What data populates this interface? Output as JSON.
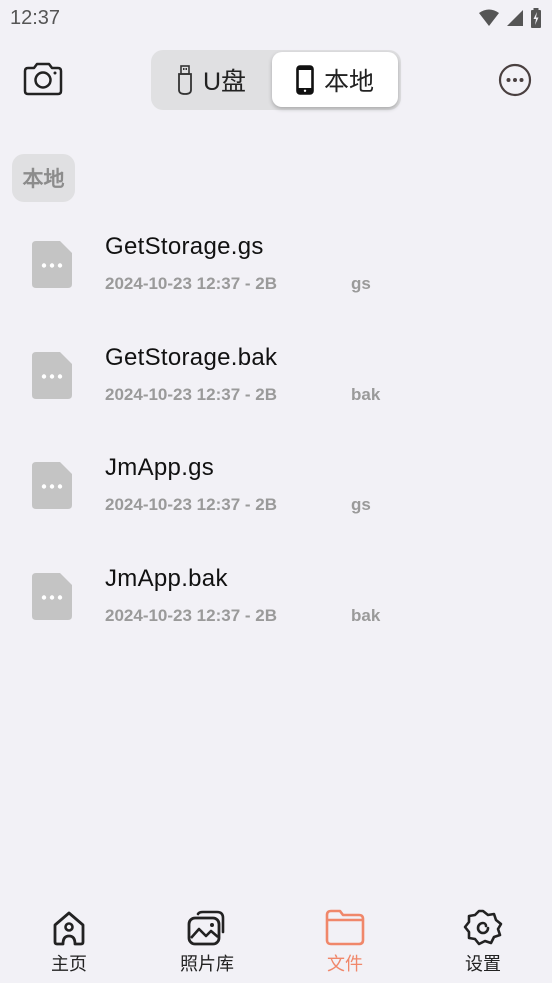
{
  "status_bar": {
    "time": "12:37",
    "icons": [
      "wifi-icon",
      "signal-icon",
      "battery-charging-icon"
    ]
  },
  "top_bar": {
    "left_icon": "camera-icon",
    "right_icon": "more-options-icon",
    "segments": [
      {
        "label": "U盘",
        "icon": "usb-drive-icon",
        "selected": false
      },
      {
        "label": "本地",
        "icon": "phone-icon",
        "selected": true
      }
    ]
  },
  "section": {
    "label": "本地"
  },
  "files": [
    {
      "name": "GetStorage.gs",
      "meta": "2024-10-23 12:37 - 2B",
      "ext": "gs",
      "icon": "file-icon"
    },
    {
      "name": "GetStorage.bak",
      "meta": "2024-10-23 12:37 - 2B",
      "ext": "bak",
      "icon": "file-icon"
    },
    {
      "name": "JmApp.gs",
      "meta": "2024-10-23 12:37 - 2B",
      "ext": "gs",
      "icon": "file-icon"
    },
    {
      "name": "JmApp.bak",
      "meta": "2024-10-23 12:37 - 2B",
      "ext": "bak",
      "icon": "file-icon"
    }
  ],
  "bottom_nav": {
    "active_color": "#f0876a",
    "items": [
      {
        "label": "主页",
        "icon": "home-icon",
        "active": false
      },
      {
        "label": "照片库",
        "icon": "gallery-icon",
        "active": false
      },
      {
        "label": "文件",
        "icon": "folder-icon",
        "active": true
      },
      {
        "label": "设置",
        "icon": "settings-icon",
        "active": false
      }
    ]
  },
  "colors": {
    "background": "#f2f1f6",
    "accent": "#f0876a",
    "file_icon": "#c4c4c4",
    "secondary_text": "#9a9a9a"
  }
}
